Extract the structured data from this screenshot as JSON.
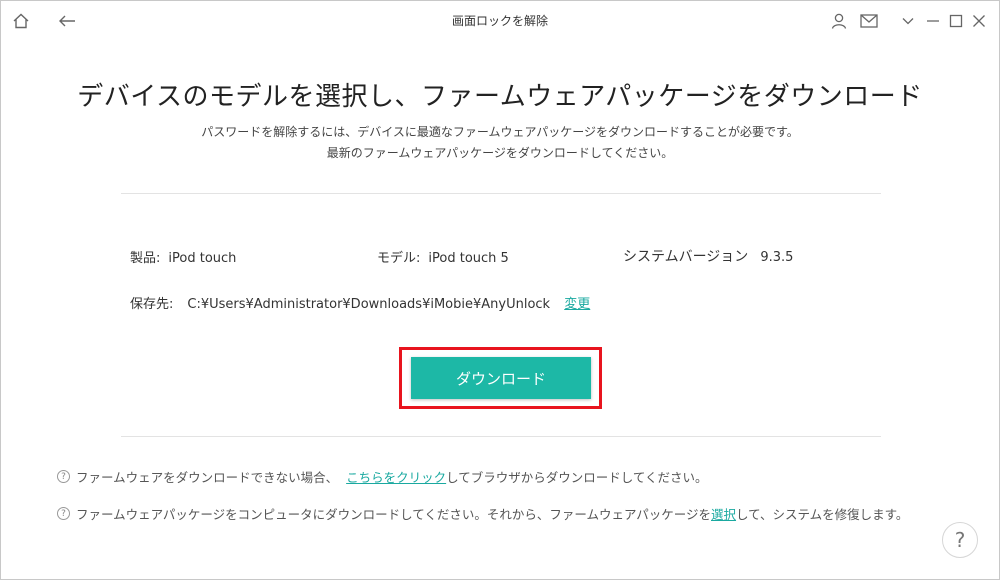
{
  "window": {
    "title": "画面ロックを解除"
  },
  "titlebar": {
    "icons": [
      "home-icon",
      "back-arrow-icon",
      "user-icon",
      "mail-icon",
      "chevron-down-icon",
      "minimize-icon",
      "maximize-icon",
      "close-icon"
    ]
  },
  "main": {
    "headline": "デバイスのモデルを選択し、ファームウェアパッケージをダウンロード",
    "subtitle_line1": "パスワードを解除するには、デバイスに最適なファームウェアパッケージをダウンロードすることが必要です。",
    "subtitle_line2": "最新のファームウェアパッケージをダウンロードしてください。"
  },
  "device": {
    "product_label": "製品:",
    "product_value": "iPod touch",
    "model_label": "モデル:",
    "model_value": "iPod touch 5",
    "system_label": "システムバージョン",
    "system_value": "9.3.5",
    "save_label": "保存先:",
    "save_path": "C:¥Users¥Administrator¥Downloads¥iMobie¥AnyUnlock",
    "change_link": "変更"
  },
  "actions": {
    "download_label": "ダウンロード"
  },
  "hints": {
    "hint1_before": "ファームウェアをダウンロードできない場合、",
    "hint1_link": "こちらをクリック",
    "hint1_after": "してブラウザからダウンロードしてください。",
    "hint2_before": "ファームウェアパッケージをコンピュータにダウンロードしてください。それから、ファームウェアパッケージを",
    "hint2_link": "選択",
    "hint2_after": "して、システムを修復します。",
    "hint_icon_glyph": "?"
  },
  "help": {
    "glyph": "?"
  },
  "colors": {
    "accent": "#1db8a6",
    "link": "#1aa9a0",
    "highlight_border": "#e8141e"
  }
}
